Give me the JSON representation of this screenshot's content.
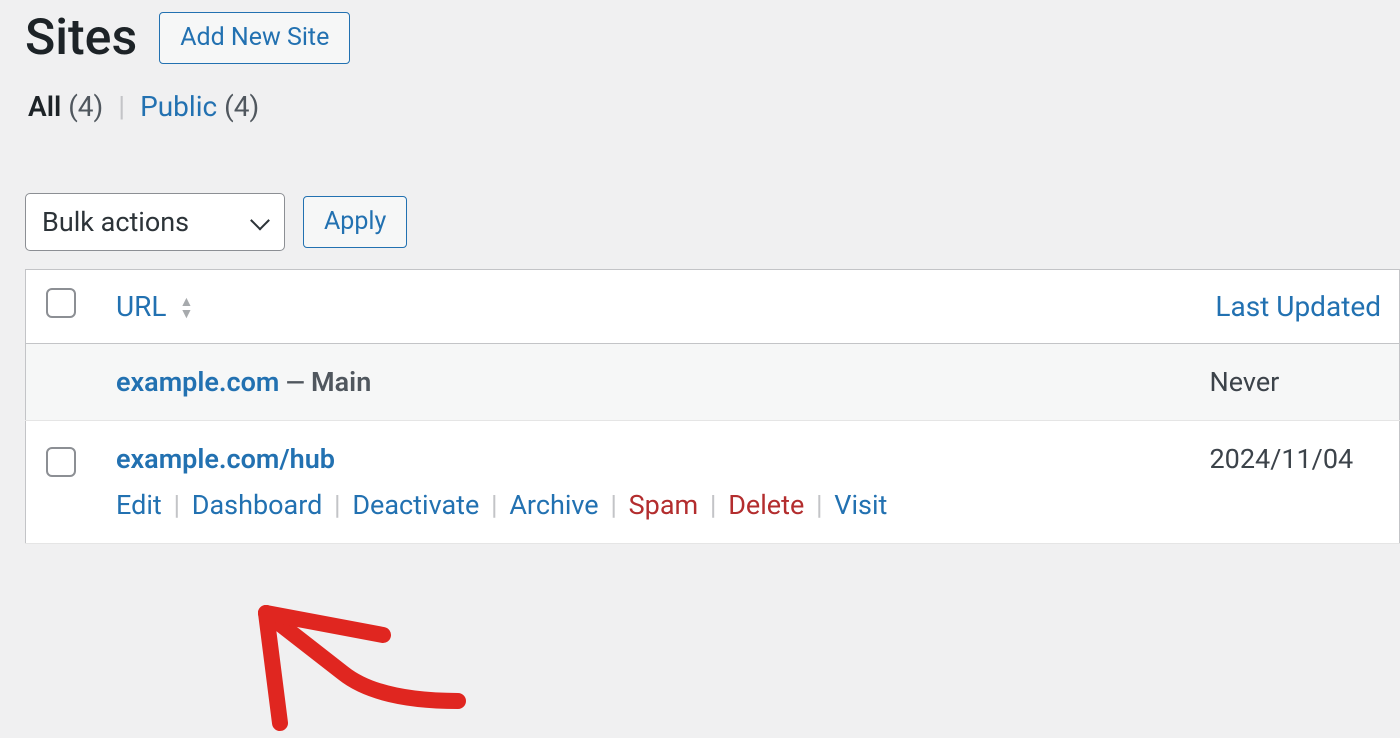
{
  "header": {
    "title": "Sites",
    "add_button": "Add New Site"
  },
  "filters": {
    "all_label": "All",
    "all_count": "(4)",
    "public_label": "Public",
    "public_count": "(4)"
  },
  "controls": {
    "bulk_label": "Bulk actions",
    "apply_label": "Apply"
  },
  "table": {
    "col_url": "URL",
    "col_updated": "Last Updated"
  },
  "rows": [
    {
      "url": "example.com",
      "main": "Main",
      "updated": "Never",
      "has_checkbox": false,
      "show_actions": false
    },
    {
      "url": "example.com/hub",
      "main": "",
      "updated": "2024/11/04",
      "has_checkbox": true,
      "show_actions": true
    }
  ],
  "actions": {
    "edit": "Edit",
    "dashboard": "Dashboard",
    "deactivate": "Deactivate",
    "archive": "Archive",
    "spam": "Spam",
    "delete": "Delete",
    "visit": "Visit"
  }
}
